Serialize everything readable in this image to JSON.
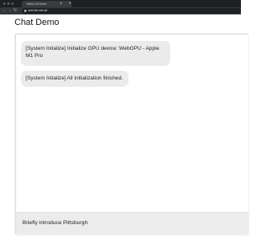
{
  "browser": {
    "tab_title": "WebLLM Demo",
    "tab_close": "×",
    "new_tab": "+",
    "nav": {
      "back": "←",
      "forward": "→",
      "reload": "↻"
    },
    "url": "web-llm.mlc.ai/"
  },
  "page": {
    "title": "Chat Demo"
  },
  "chat": {
    "messages": [
      {
        "role": "system",
        "text": "[System Initalize] Initialize GPU device: WebGPU - Apple M1 Pro"
      },
      {
        "role": "system",
        "text": "[System Initalize] All initialization finished."
      }
    ],
    "input": {
      "value": "Briefly introduce Pittsburgh"
    }
  }
}
